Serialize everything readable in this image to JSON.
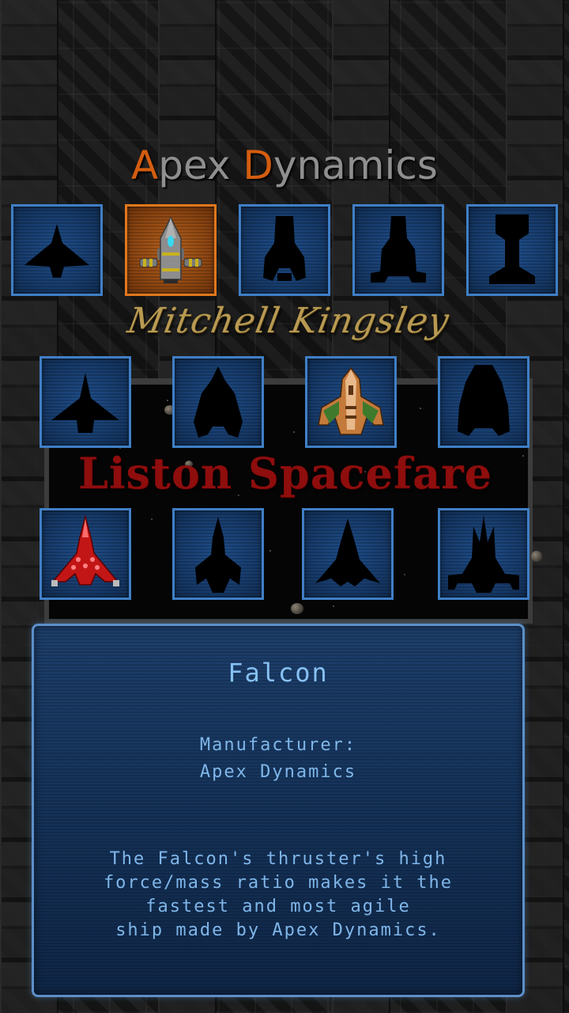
{
  "header": {
    "manufacturer_initial_1": "A",
    "manufacturer_rest_1": "pex ",
    "manufacturer_initial_2": "D",
    "manufacturer_rest_2": "ynamics"
  },
  "pilot_name": "Mitchell Kingsley",
  "faction_name": "Liston Spacefare",
  "ship_rows": {
    "apex": [
      {
        "icon": "delta-fighter-silhouette-icon",
        "locked": true
      },
      {
        "icon": "falcon-ship-icon",
        "locked": false,
        "selected": true
      },
      {
        "icon": "lander-silhouette-icon",
        "locked": true
      },
      {
        "icon": "freighter-silhouette-icon",
        "locked": true
      },
      {
        "icon": "tower-silhouette-icon",
        "locked": true
      }
    ],
    "mitchell": [
      {
        "icon": "swept-fighter-silhouette-icon",
        "locked": true
      },
      {
        "icon": "heavy-cruiser-silhouette-icon",
        "locked": true
      },
      {
        "icon": "striker-ship-icon",
        "locked": false
      },
      {
        "icon": "gunship-silhouette-icon",
        "locked": true
      }
    ],
    "liston": [
      {
        "icon": "red-interceptor-ship-icon",
        "locked": false
      },
      {
        "icon": "dart-silhouette-icon",
        "locked": true
      },
      {
        "icon": "arrow-silhouette-icon",
        "locked": true
      },
      {
        "icon": "spire-silhouette-icon",
        "locked": true
      }
    ]
  },
  "colors": {
    "accent_orange": "#d45d10",
    "tile_blue": "#3f7fc6",
    "panel_text": "#7fb6e9"
  },
  "info_panel": {
    "ship_name": "Falcon",
    "manufacturer_label": "Manufacturer:",
    "manufacturer_value": "Apex Dynamics",
    "description_lines": [
      "The Falcon's thruster's high",
      "force/mass ratio makes it the",
      "fastest and most agile",
      "ship made by Apex Dynamics."
    ]
  }
}
